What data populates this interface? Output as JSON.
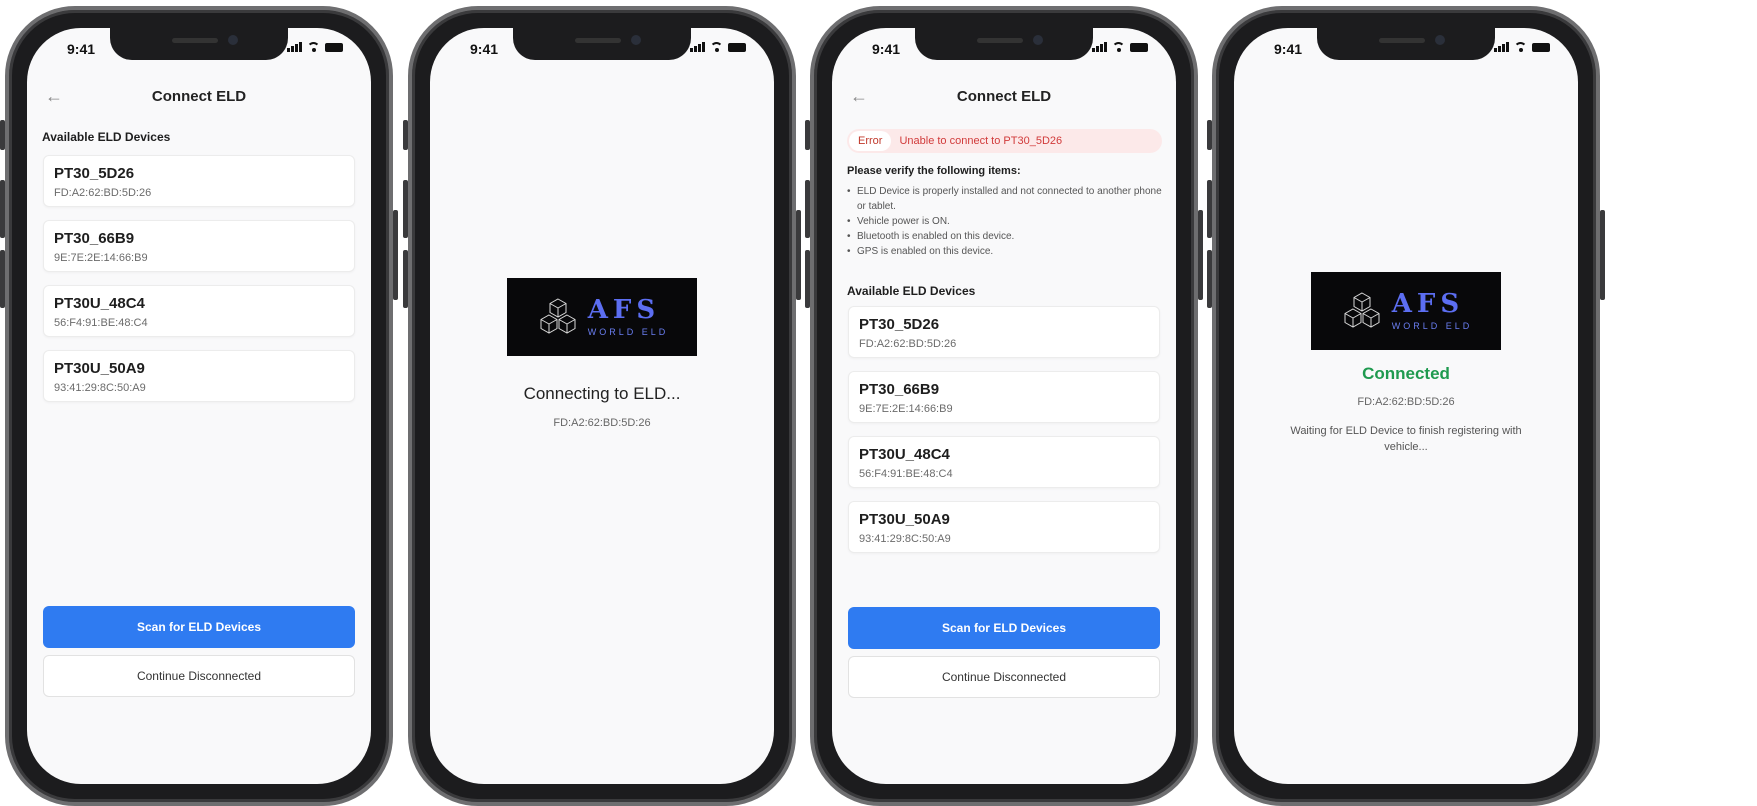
{
  "status_bar": {
    "time": "9:41"
  },
  "connect_screen": {
    "title": "Connect ELD",
    "section_label": "Available ELD Devices",
    "devices": [
      {
        "name": "PT30_5D26",
        "mac": "FD:A2:62:BD:5D:26"
      },
      {
        "name": "PT30_66B9",
        "mac": "9E:7E:2E:14:66:B9"
      },
      {
        "name": "PT30U_48C4",
        "mac": "56:F4:91:BE:48:C4"
      },
      {
        "name": "PT30U_50A9",
        "mac": "93:41:29:8C:50:A9"
      }
    ],
    "scan_button": "Scan for ELD Devices",
    "continue_button": "Continue Disconnected"
  },
  "logo": {
    "text": "AFS",
    "subtitle": "WORLD ELD"
  },
  "connecting_screen": {
    "message": "Connecting to ELD...",
    "mac": "FD:A2:62:BD:5D:26"
  },
  "error_screen": {
    "error_tag": "Error",
    "error_message": "Unable to connect to PT30_5D26",
    "verify_title": "Please verify the following items:",
    "verify_items": [
      "ELD Device is properly installed and not connected to another phone or tablet.",
      "Vehicle power is ON.",
      "Bluetooth is enabled on this device.",
      "GPS is enabled on this device."
    ]
  },
  "connected_screen": {
    "status": "Connected",
    "mac": "FD:A2:62:BD:5D:26",
    "message": "Waiting for ELD Device to finish registering with vehicle..."
  },
  "colors": {
    "primary": "#2f7bf1",
    "success": "#1f9a4f",
    "error": "#d13b3b",
    "logo_accent": "#5c6ef2"
  }
}
